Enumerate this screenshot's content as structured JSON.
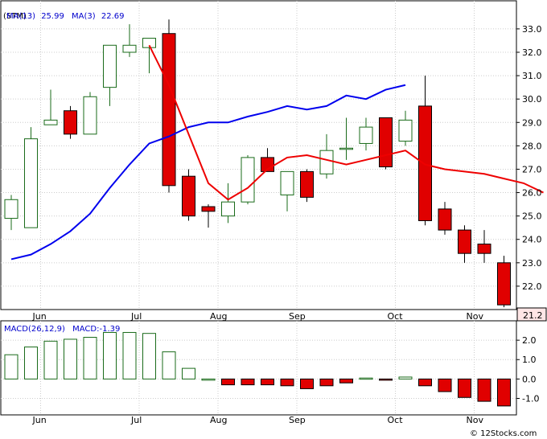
{
  "colors": {
    "up": "#1a6b1a",
    "down": "#e00000",
    "ma13": "#0000ee",
    "ma3": "#ee0000",
    "grid": "#cccccc",
    "frame": "#000000",
    "last_price_bg": "#ffe6e6"
  },
  "chart_data": [
    {
      "type": "candlestick",
      "legend": {
        "symbol": "(STM)",
        "ma13_label": "MA(13)",
        "ma13_value": "25.99",
        "ma3_label": "MA(3)",
        "ma3_value": "22.69"
      },
      "ylim": [
        21.0,
        34.2
      ],
      "y_ticks": [
        "22.0",
        "23.0",
        "24.0",
        "25.0",
        "26.0",
        "27.0",
        "28.0",
        "29.0",
        "30.0",
        "31.0",
        "32.0",
        "33.0"
      ],
      "last_price": "21.2",
      "x_month_labels": [
        {
          "label": "Jun",
          "index": 1
        },
        {
          "label": "Jul",
          "index": 6
        },
        {
          "label": "Aug",
          "index": 10
        },
        {
          "label": "Sep",
          "index": 14
        },
        {
          "label": "Oct",
          "index": 19
        },
        {
          "label": "Nov",
          "index": 23
        }
      ],
      "candles": [
        {
          "open": 24.9,
          "high": 25.9,
          "low": 24.4,
          "close": 25.7
        },
        {
          "open": 24.5,
          "high": 28.8,
          "low": 24.5,
          "close": 28.3
        },
        {
          "open": 28.9,
          "high": 30.4,
          "low": 28.9,
          "close": 29.1
        },
        {
          "open": 29.5,
          "high": 29.7,
          "low": 28.3,
          "close": 28.5
        },
        {
          "open": 28.5,
          "high": 30.3,
          "low": 28.5,
          "close": 30.1
        },
        {
          "open": 30.5,
          "high": 32.3,
          "low": 29.7,
          "close": 32.3
        },
        {
          "open": 32.0,
          "high": 33.2,
          "low": 31.8,
          "close": 32.3
        },
        {
          "open": 32.2,
          "high": 32.6,
          "low": 31.1,
          "close": 32.6
        },
        {
          "open": 32.8,
          "high": 33.4,
          "low": 26.0,
          "close": 26.3
        },
        {
          "open": 26.7,
          "high": 27.0,
          "low": 24.8,
          "close": 25.0
        },
        {
          "open": 25.4,
          "high": 25.5,
          "low": 24.5,
          "close": 25.2
        },
        {
          "open": 25.0,
          "high": 26.4,
          "low": 24.7,
          "close": 25.6
        },
        {
          "open": 25.6,
          "high": 27.6,
          "low": 25.5,
          "close": 27.5
        },
        {
          "open": 27.5,
          "high": 27.9,
          "low": 26.9,
          "close": 26.9
        },
        {
          "open": 25.9,
          "high": 26.9,
          "low": 25.2,
          "close": 26.9
        },
        {
          "open": 26.9,
          "high": 27.0,
          "low": 25.6,
          "close": 25.8
        },
        {
          "open": 26.8,
          "high": 28.5,
          "low": 26.6,
          "close": 27.8
        },
        {
          "open": 27.9,
          "high": 29.2,
          "low": 27.4,
          "close": 27.9
        },
        {
          "open": 28.1,
          "high": 29.2,
          "low": 27.8,
          "close": 28.8
        },
        {
          "open": 29.2,
          "high": 29.2,
          "low": 27.0,
          "close": 27.1
        },
        {
          "open": 28.2,
          "high": 29.5,
          "low": 28.0,
          "close": 29.1
        },
        {
          "open": 29.7,
          "high": 31.0,
          "low": 24.6,
          "close": 24.8
        },
        {
          "open": 25.3,
          "high": 25.6,
          "low": 24.2,
          "close": 24.4
        },
        {
          "open": 24.4,
          "high": 24.6,
          "low": 23.0,
          "close": 23.4
        },
        {
          "open": 23.8,
          "high": 24.4,
          "low": 23.0,
          "close": 23.4
        },
        {
          "open": 23.0,
          "high": 23.3,
          "low": 21.1,
          "close": 21.2
        }
      ],
      "ma13": [
        23.15,
        23.35,
        23.8,
        24.35,
        25.1,
        26.2,
        27.2,
        28.1,
        28.4,
        28.8,
        29.0,
        29.0,
        29.25,
        29.45,
        29.7,
        29.55,
        29.7,
        30.15,
        30.0,
        30.4,
        30.6
      ],
      "ma13_start_index": 0,
      "ma3": [
        32.3,
        30.6,
        28.5,
        26.4,
        25.7,
        26.2,
        27.0,
        27.5,
        27.6,
        27.4,
        27.2,
        27.4,
        27.6,
        27.8,
        27.2,
        27.0,
        26.9,
        26.8,
        26.6,
        26.4,
        26.0
      ],
      "ma3_start_index": 7
    },
    {
      "type": "bar",
      "legend": {
        "label": "MACD(26,12,9)",
        "value_label": "MACD:",
        "value": "-1.39"
      },
      "ylim": [
        -1.85,
        3.0
      ],
      "y_ticks": [
        "2.0",
        "1.0",
        "0.0",
        "-1.0"
      ],
      "y_tick_values": [
        2.0,
        1.0,
        0.0,
        -1.0
      ],
      "values": [
        1.25,
        1.65,
        1.95,
        2.05,
        2.15,
        2.4,
        2.4,
        2.35,
        1.4,
        0.55,
        0.0,
        -0.3,
        -0.3,
        -0.3,
        -0.35,
        -0.5,
        -0.35,
        -0.2,
        0.05,
        -0.05,
        0.1,
        -0.35,
        -0.65,
        -0.95,
        -1.15,
        -1.39
      ]
    }
  ],
  "watermark": "© 12Stocks.com"
}
